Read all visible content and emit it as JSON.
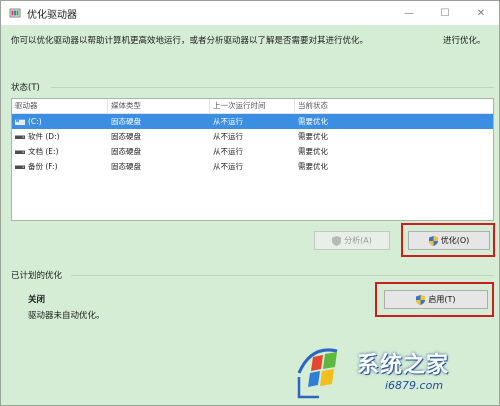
{
  "window": {
    "title": "优化驱动器",
    "minimize_glyph": "—",
    "maximize_glyph": "☐",
    "close_glyph": "✕"
  },
  "description": "你可以优化驱动器以帮助计算机更高效地运行，或者分析驱动器以了解是否需要对其进行优化。",
  "description_tail": "进行优化。",
  "status_label": "状态(T)",
  "table": {
    "columns": [
      "驱动器",
      "媒体类型",
      "上一次运行时间",
      "当前状态"
    ],
    "rows": [
      {
        "drive": "(C:)",
        "media": "固态硬盘",
        "last_run": "从不运行",
        "status": "需要优化",
        "selected": true,
        "icon": "windows-drive-icon"
      },
      {
        "drive": "软件 (D:)",
        "media": "固态硬盘",
        "last_run": "从不运行",
        "status": "需要优化",
        "selected": false,
        "icon": "drive-icon"
      },
      {
        "drive": "文档 (E:)",
        "media": "固态硬盘",
        "last_run": "从不运行",
        "status": "需要优化",
        "selected": false,
        "icon": "drive-icon"
      },
      {
        "drive": "备份 (F:)",
        "media": "固态硬盘",
        "last_run": "从不运行",
        "status": "需要优化",
        "selected": false,
        "icon": "drive-icon"
      }
    ]
  },
  "buttons": {
    "analyze": "分析(A)",
    "optimize": "优化(O)",
    "enable": "启用(T)"
  },
  "scheduled": {
    "label": "已计划的优化",
    "state": "关闭",
    "note": "驱动器未自动优化。"
  },
  "watermark": {
    "title": "系统之家",
    "url": "i6879.com"
  },
  "colors": {
    "window_bg": "#d5ecd5",
    "selected_row": "#3b8ee1",
    "highlight_box": "#c8201e"
  }
}
